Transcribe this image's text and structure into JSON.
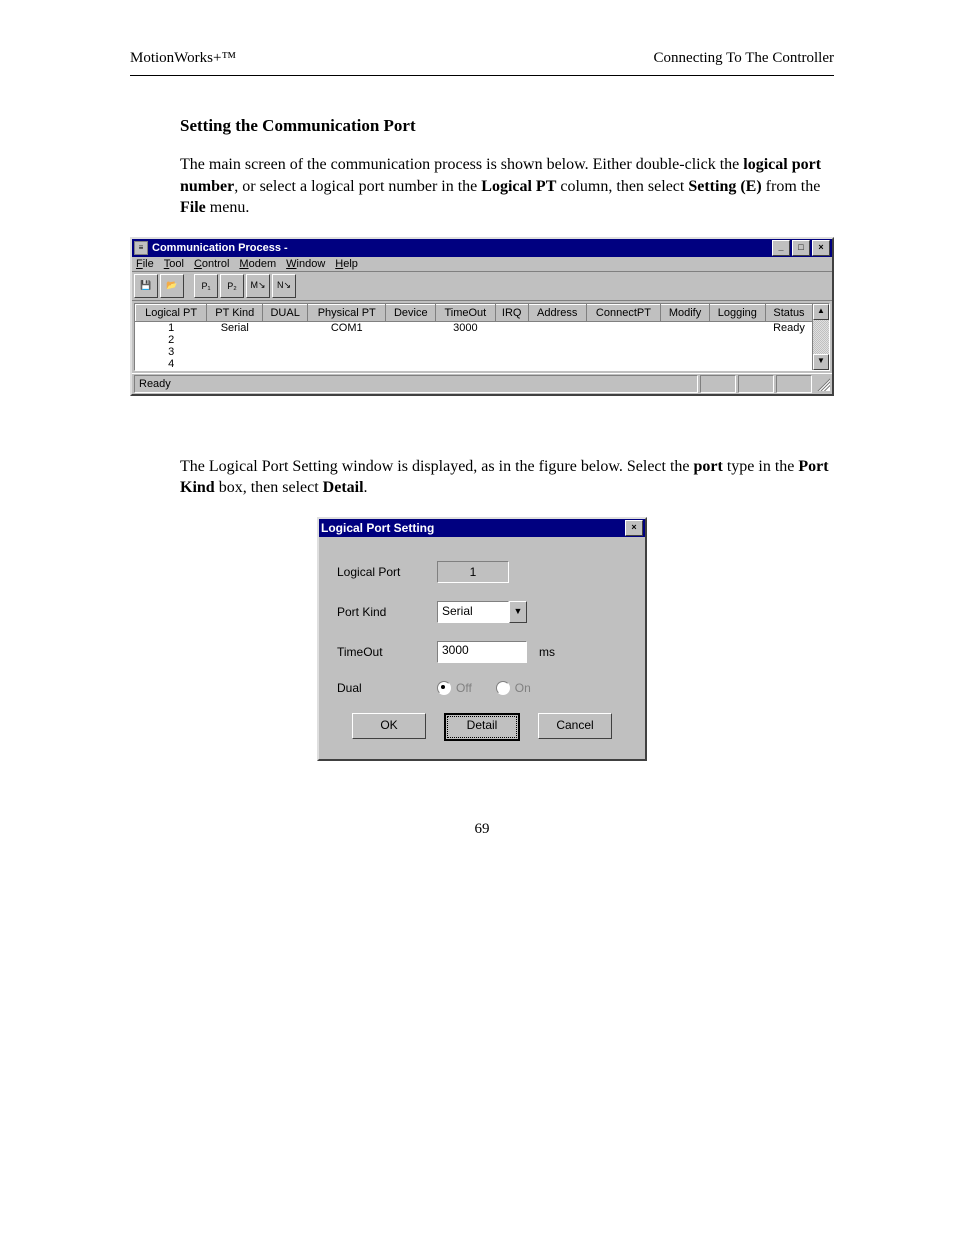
{
  "doc": {
    "header_left": "MotionWorks+™",
    "header_right": "Connecting To The Controller",
    "section_title": "Setting the Communication Port",
    "para1_a": "The main screen of the communication process is shown below.  Either double-click the ",
    "para1_b": "logical port number",
    "para1_c": ", or select a logical port number in the ",
    "para1_d": "Logical PT",
    "para1_e": " column, then select ",
    "para1_f": "Setting (E)",
    "para1_g": " from the ",
    "para1_h": "File",
    "para1_i": " menu.",
    "para2_a": "The Logical Port Setting window is displayed, as in the figure below. Select the ",
    "para2_b": "port",
    "para2_c": " type in the ",
    "para2_d": "Port Kind",
    "para2_e": " box, then select ",
    "para2_f": "Detail",
    "para2_g": ".",
    "page_number": "69"
  },
  "main": {
    "title": "Communication Process -",
    "menus": {
      "file": "File",
      "tool": "Tool",
      "control": "Control",
      "modem": "Modem",
      "window": "Window",
      "help": "Help"
    },
    "tool_icons": {
      "save": "💾",
      "open": "📂",
      "p1": "P₁",
      "p2": "P₂",
      "m": "M↘",
      "n": "N↘"
    },
    "columns": {
      "c0": "Logical PT",
      "c1": "PT Kind",
      "c2": "DUAL",
      "c3": "Physical PT",
      "c4": "Device",
      "c5": "TimeOut",
      "c6": "IRQ",
      "c7": "Address",
      "c8": "ConnectPT",
      "c9": "Modify",
      "c10": "Logging",
      "c11": "Status"
    },
    "rows": {
      "r1": {
        "pt": "1",
        "kind": "Serial",
        "phys": "COM1",
        "timeout": "3000",
        "status": "Ready"
      },
      "r2": {
        "pt": "2"
      },
      "r3": {
        "pt": "3"
      },
      "r4": {
        "pt": "4"
      }
    },
    "status": "Ready",
    "sys": {
      "min": "_",
      "max": "□",
      "close": "×",
      "up": "▲",
      "down": "▼"
    }
  },
  "dialog": {
    "title": "Logical Port Setting",
    "close": "×",
    "labels": {
      "logical_port": "Logical Port",
      "port_kind": "Port Kind",
      "timeout": "TimeOut",
      "dual": "Dual"
    },
    "values": {
      "logical_port": "1",
      "port_kind": "Serial",
      "timeout": "3000",
      "unit": "ms",
      "off": "Off",
      "on": "On"
    },
    "buttons": {
      "ok": "OK",
      "detail": "Detail",
      "cancel": "Cancel"
    },
    "dropdown_arrow": "▼"
  }
}
